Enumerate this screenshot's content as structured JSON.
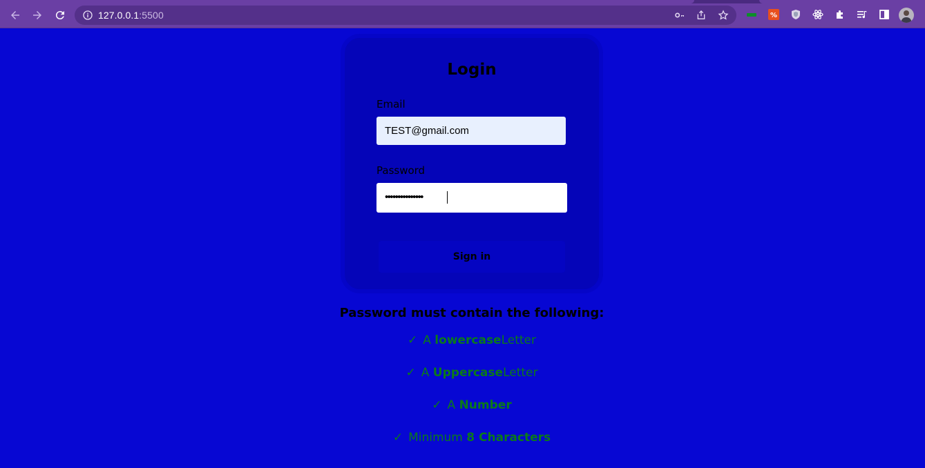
{
  "browser": {
    "url_host": "127.0.0.1",
    "url_port": ":5500",
    "icons": {
      "back": "arrow-left-icon",
      "forward": "arrow-right-icon",
      "reload": "reload-icon",
      "info": "info-icon",
      "key": "key-icon",
      "share": "share-icon",
      "star": "star-icon"
    },
    "extensions": [
      "ext-green-icon",
      "ext-translate-icon",
      "ext-shield-icon",
      "ext-react-icon",
      "puzzle-icon",
      "media-queue-icon",
      "sidepanel-icon"
    ]
  },
  "login": {
    "title": "Login",
    "email_label": "Email",
    "email_value": "TEST@gmail.com",
    "password_label": "Password",
    "password_value": "•••••••••••••••",
    "signin_label": "Sign in"
  },
  "rules": {
    "title": "Password must contain the following:",
    "check_symbol": "✓",
    "items": [
      {
        "prefix": "A ",
        "bold": "lowercase",
        "suffix": "Letter"
      },
      {
        "prefix": "A ",
        "bold": "Uppercase",
        "suffix": "Letter"
      },
      {
        "prefix": "A ",
        "bold": "Number",
        "suffix": ""
      },
      {
        "prefix": "Minimum ",
        "bold": "8 Characters",
        "suffix": ""
      }
    ]
  },
  "colors": {
    "page_bg": "#0707d3",
    "card_bg": "#0505b8",
    "rule_green": "#0a7a1a",
    "chrome": "#6a3fa4"
  }
}
